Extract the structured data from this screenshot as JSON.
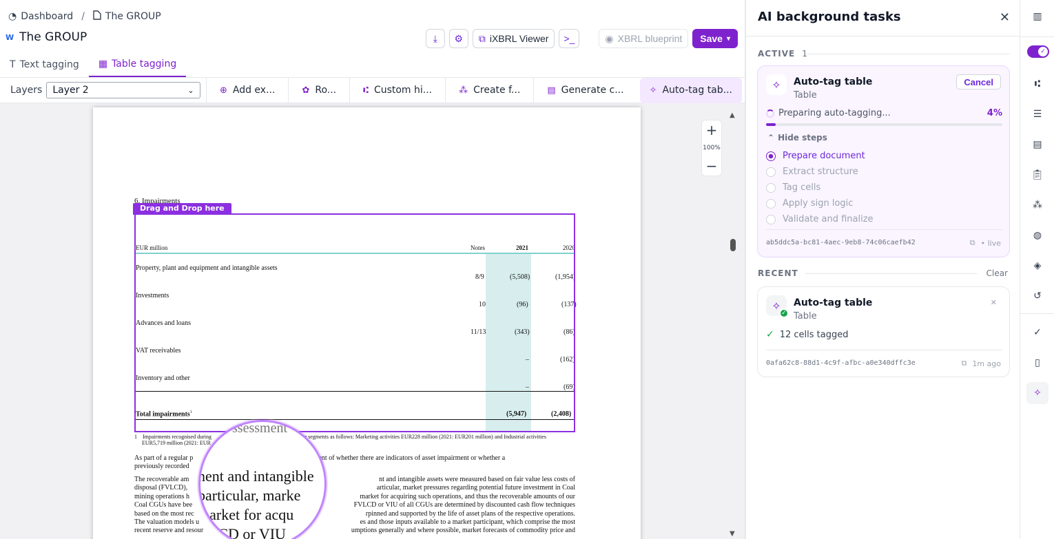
{
  "breadcrumb": {
    "home": "Dashboard",
    "separator": "/",
    "current": "The GROUP"
  },
  "document": {
    "title": "The GROUP",
    "icon": "W"
  },
  "toolbar": {
    "download_icon": "download-icon",
    "settings_icon": "gear-icon",
    "ixbrl_viewer": "iXBRL Viewer",
    "terminal_icon": "terminal-icon",
    "xbrl_blueprint": "XBRL blueprint",
    "save": "Save"
  },
  "tabs": [
    {
      "label": "Text tagging"
    },
    {
      "label": "Table tagging"
    }
  ],
  "layer_bar": {
    "label": "Layers",
    "selected_layer": "Layer 2",
    "actions": [
      "Add ex...",
      "Ro...",
      "Custom hi...",
      "Create f...",
      "Generate c...",
      "Auto-tag tab..."
    ]
  },
  "zoom": {
    "plus": "+",
    "level": "100%",
    "minus": "−"
  },
  "page": {
    "section_title": "6. Impairments",
    "drop_label": "Drag and Drop here",
    "table": {
      "header": {
        "label": "EUR million",
        "notes": "Notes",
        "y2021": "2021",
        "y2020": "2020"
      },
      "rows": [
        {
          "label": "Property, plant and equipment and intangible assets",
          "notes": "8/9",
          "v2021": "(5,508)",
          "v2020": "(1,954)"
        },
        {
          "label": "Investments",
          "notes": "10",
          "v2021": "(96)",
          "v2020": "(137)"
        },
        {
          "label": "Advances and loans",
          "notes": "11/13",
          "v2021": "(343)",
          "v2020": "(86)"
        },
        {
          "label": "VAT receivables",
          "notes": "",
          "v2021": "–",
          "v2020": "(162)"
        },
        {
          "label": "Inventory and other",
          "notes": "",
          "v2021": "–",
          "v2020": "(69)"
        }
      ],
      "total": {
        "label": "Total impairments",
        "sup": "1",
        "v2021": "(5,947)",
        "v2020": "(2,408)"
      }
    },
    "footnote_num": "1",
    "footnote_a": "Impairments recognised during",
    "footnote_b": "erating segments as follows: Marketing activities EUR228 million (2021: EUR201 million) and Industrial activities",
    "footnote_c": "EUR5,719 million (2021: EUR",
    "para1_a": "As part of a regular p",
    "para1_b": "assessment of whether there are indicators of asset impairment or whether a",
    "para1_c": "previously recorded",
    "para2_lines": [
      [
        "The recoverable am",
        "nt and intangible assets were measured based on fair value less costs of"
      ],
      [
        "disposal (FVLCD),",
        "articular, market pressures regarding potential future investment in Coal"
      ],
      [
        "mining operations h",
        "market for acquiring such operations, and thus the recoverable amounts of our"
      ],
      [
        "Coal CGUs have bee",
        "FVLCD or VIU of all CGUs are determined by discounted cash flow techniques"
      ],
      [
        "based on the most rec",
        "rpinned and supported by the life of asset plans of the respective operations."
      ],
      [
        "The valuation models u",
        "es and those inputs available to a market participant, which comprise the most"
      ],
      [
        "recent reserve and resour",
        "umptions generally and where possible, market forecasts of commodity price and"
      ]
    ],
    "magnifier_lines": [
      "ssessment",
      "nent and intangible",
      "particular, marke",
      "market for acqu",
      "VLCD or VIU"
    ]
  },
  "panel": {
    "title": "AI background tasks",
    "active_label": "ACTIVE",
    "active_count": "1",
    "recent_label": "RECENT",
    "clear_label": "Clear",
    "active_task": {
      "title": "Auto-tag table",
      "subtitle": "Table",
      "cancel": "Cancel",
      "status": "Preparing auto-tagging...",
      "percent_label": "4%",
      "progress": 0.04,
      "toggle_steps": "Hide steps",
      "steps": [
        "Prepare document",
        "Extract structure",
        "Tag cells",
        "Apply sign logic",
        "Validate and finalize"
      ],
      "id": "ab5ddc5a-bc81-4aec-9eb8-74c06caefb42",
      "state": "live"
    },
    "recent_task": {
      "title": "Auto-tag table",
      "subtitle": "Table",
      "result": "12 cells tagged",
      "id": "0afa62c8-88d1-4c9f-afbc-a0e340dffc3e",
      "time": "1m ago"
    }
  },
  "colors": {
    "accent": "#7e22ce",
    "success": "#16a34a",
    "highlight": "#d8eeee"
  }
}
